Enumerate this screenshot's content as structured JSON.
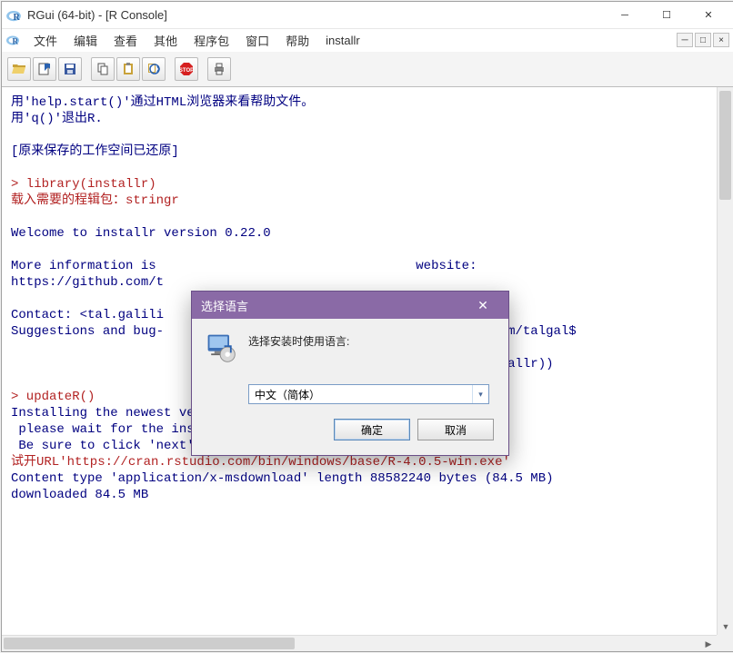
{
  "window": {
    "title": "RGui (64-bit) - [R Console]"
  },
  "menu": {
    "items": [
      "文件",
      "编辑",
      "查看",
      "其他",
      "程序包",
      "窗口",
      "帮助",
      "installr"
    ]
  },
  "toolbar": {
    "buttons": [
      "open",
      "load-workspace",
      "save",
      "copy",
      "paste",
      "copy-paste",
      "stop",
      "print"
    ]
  },
  "console": {
    "lines": [
      {
        "c": "blue",
        "t": "用'help.start()'通过HTML浏览器来看帮助文件。"
      },
      {
        "c": "blue",
        "t": "用'q()'退出R."
      },
      {
        "c": "blue",
        "t": ""
      },
      {
        "c": "blue",
        "t": "[原来保存的工作空间已还原]"
      },
      {
        "c": "blue",
        "t": ""
      },
      {
        "c": "red",
        "t": "> library(installr)"
      },
      {
        "c": "red",
        "t": "载入需要的程辑包：stringr"
      },
      {
        "c": "blue",
        "t": ""
      },
      {
        "c": "blue",
        "t": "Welcome to installr version 0.22.0"
      },
      {
        "c": "blue",
        "t": ""
      },
      {
        "c": "blue",
        "t": "More information is                                  website:"
      },
      {
        "c": "blue",
        "t": "https://github.com/t"
      },
      {
        "c": "blue",
        "t": ""
      },
      {
        "c": "blue",
        "t": "Contact: <tal.galili"
      },
      {
        "c": "blue",
        "t": "Suggestions and bug-                                 ://github.com/talgal$"
      },
      {
        "c": "blue",
        "t": ""
      },
      {
        "c": "blue",
        "t": "                                                    (library(installr))"
      },
      {
        "c": "blue",
        "t": ""
      },
      {
        "c": "red",
        "t": "> updateR()"
      },
      {
        "c": "blue",
        "t": "Installing the newest version of R,"
      },
      {
        "c": "blue",
        "t": " please wait for the installer file to be download and executed."
      },
      {
        "c": "blue",
        "t": " Be sure to click 'next' as needed..."
      },
      {
        "c": "red",
        "t": "试开URL'https://cran.rstudio.com/bin/windows/base/R-4.0.5-win.exe'"
      },
      {
        "c": "blue",
        "t": "Content type 'application/x-msdownload' length 88582240 bytes (84.5 MB)"
      },
      {
        "c": "blue",
        "t": "downloaded 84.5 MB"
      },
      {
        "c": "blue",
        "t": ""
      }
    ]
  },
  "dialog": {
    "title": "选择语言",
    "label": "选择安装时使用语言:",
    "selected": "中文（简体）",
    "ok": "确定",
    "cancel": "取消"
  }
}
